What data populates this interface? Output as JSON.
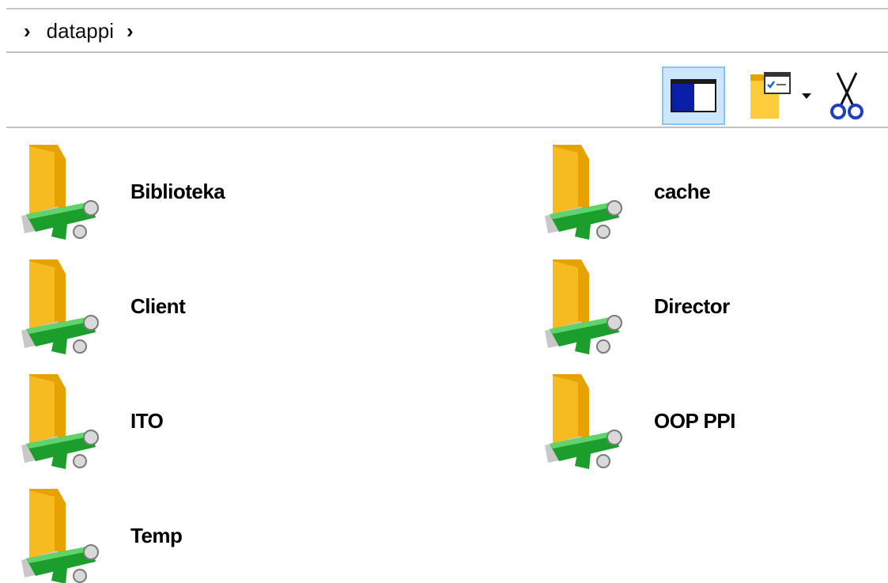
{
  "address": {
    "crumbs": [
      "datappi"
    ]
  },
  "toolbar": {
    "buttons": [
      {
        "name": "preview-pane",
        "icon": "preview-pane-icon",
        "active": true
      },
      {
        "name": "properties",
        "icon": "properties-icon",
        "active": false,
        "has_dropdown": true
      },
      {
        "name": "cut",
        "icon": "scissors-icon",
        "active": false
      }
    ]
  },
  "items": [
    {
      "label": "Biblioteka",
      "icon": "network-folder-icon"
    },
    {
      "label": "cache",
      "icon": "network-folder-icon"
    },
    {
      "label": "Client",
      "icon": "network-folder-icon"
    },
    {
      "label": "Director",
      "icon": "network-folder-icon"
    },
    {
      "label": "ITO",
      "icon": "network-folder-icon"
    },
    {
      "label": "OOP PPI",
      "icon": "network-folder-icon"
    },
    {
      "label": "Temp",
      "icon": "network-folder-icon"
    }
  ],
  "colors": {
    "folder_dark": "#e6a300",
    "folder_light": "#ffd65c",
    "cable_green": "#1c9e2c",
    "active_btn_bg": "#cce6fb",
    "active_btn_border": "#88c4f2",
    "scissors_blue": "#1f3fbf"
  }
}
